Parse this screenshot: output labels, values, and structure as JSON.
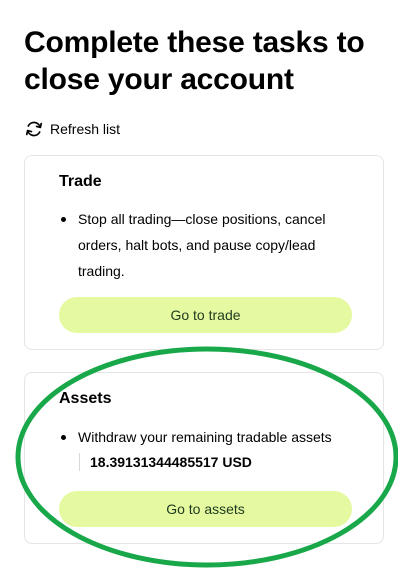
{
  "page": {
    "title": "Complete these tasks to close your account"
  },
  "refresh": {
    "label": "Refresh list",
    "icon": "refresh-icon"
  },
  "tasks": [
    {
      "title": "Trade",
      "bullet": "Stop all trading—close positions, cancel orders, halt bots, and pause copy/lead trading.",
      "button_label": "Go to trade"
    },
    {
      "title": "Assets",
      "bullet": "Withdraw your remaining tradable assets",
      "amount": "18.39131344485517 USD",
      "button_label": "Go to assets"
    }
  ],
  "colors": {
    "button_background": "#e4f9a0",
    "button_text": "#1f3a1f",
    "card_border": "#e5e5e5",
    "highlight_annotation": "#18a84a"
  }
}
